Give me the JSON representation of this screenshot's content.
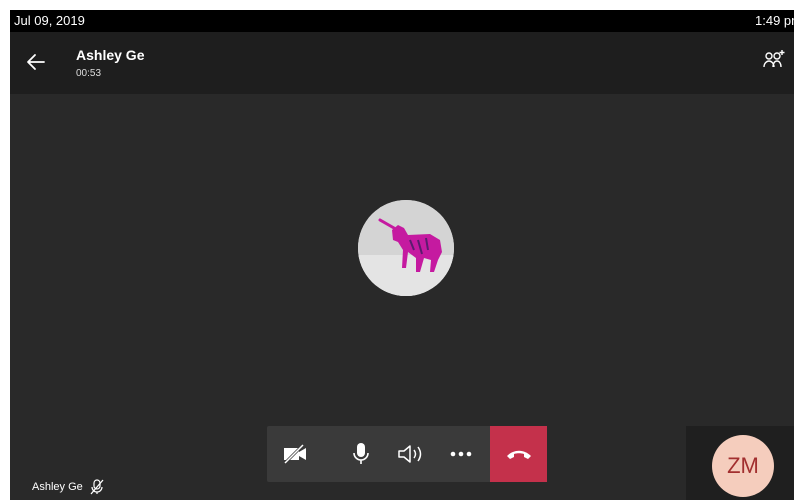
{
  "status": {
    "date": "Jul 09, 2019",
    "time": "1:49 pm"
  },
  "call": {
    "caller_name": "Ashley Ge",
    "duration": "00:53"
  },
  "self": {
    "initials": "ZM"
  },
  "participant_label": "Ashley Ge",
  "colors": {
    "hangup": "#c4314b",
    "background": "#292929",
    "header": "#1e1e1e",
    "self_avatar_bg": "#f5cdbd",
    "self_avatar_text": "#a22f2f"
  },
  "icons": [
    "back-arrow-icon",
    "add-people-icon",
    "video-off-icon",
    "microphone-icon",
    "speaker-icon",
    "more-options-icon",
    "hang-up-icon",
    "mic-muted-icon"
  ]
}
